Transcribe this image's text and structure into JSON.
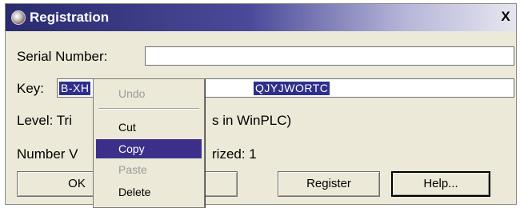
{
  "window": {
    "title": "Registration",
    "close_label": "X"
  },
  "form": {
    "serial_label": "Serial Number:",
    "serial_value": "",
    "key_label": "Key:",
    "key_value_left": "B-XH",
    "key_value_right": "QJYJWORTC",
    "level_left": "Level: Tri",
    "level_right": "s in WinPLC)",
    "number_left": "Number V",
    "number_right": "rized: 1"
  },
  "buttons": {
    "ok": "OK",
    "register": "Register",
    "help": "Help..."
  },
  "context_menu": {
    "items": [
      {
        "label": "Undo",
        "enabled": false
      },
      {
        "label": "Cut",
        "enabled": true
      },
      {
        "label": "Copy",
        "enabled": true,
        "highlighted": true
      },
      {
        "label": "Paste",
        "enabled": false
      },
      {
        "label": "Delete",
        "enabled": true
      }
    ]
  },
  "colors": {
    "title_bar": "#2a2a6e",
    "selection": "#2e2e8c",
    "menu_highlight": "#3b2f8a",
    "dialog_bg": "#ece9d8"
  }
}
